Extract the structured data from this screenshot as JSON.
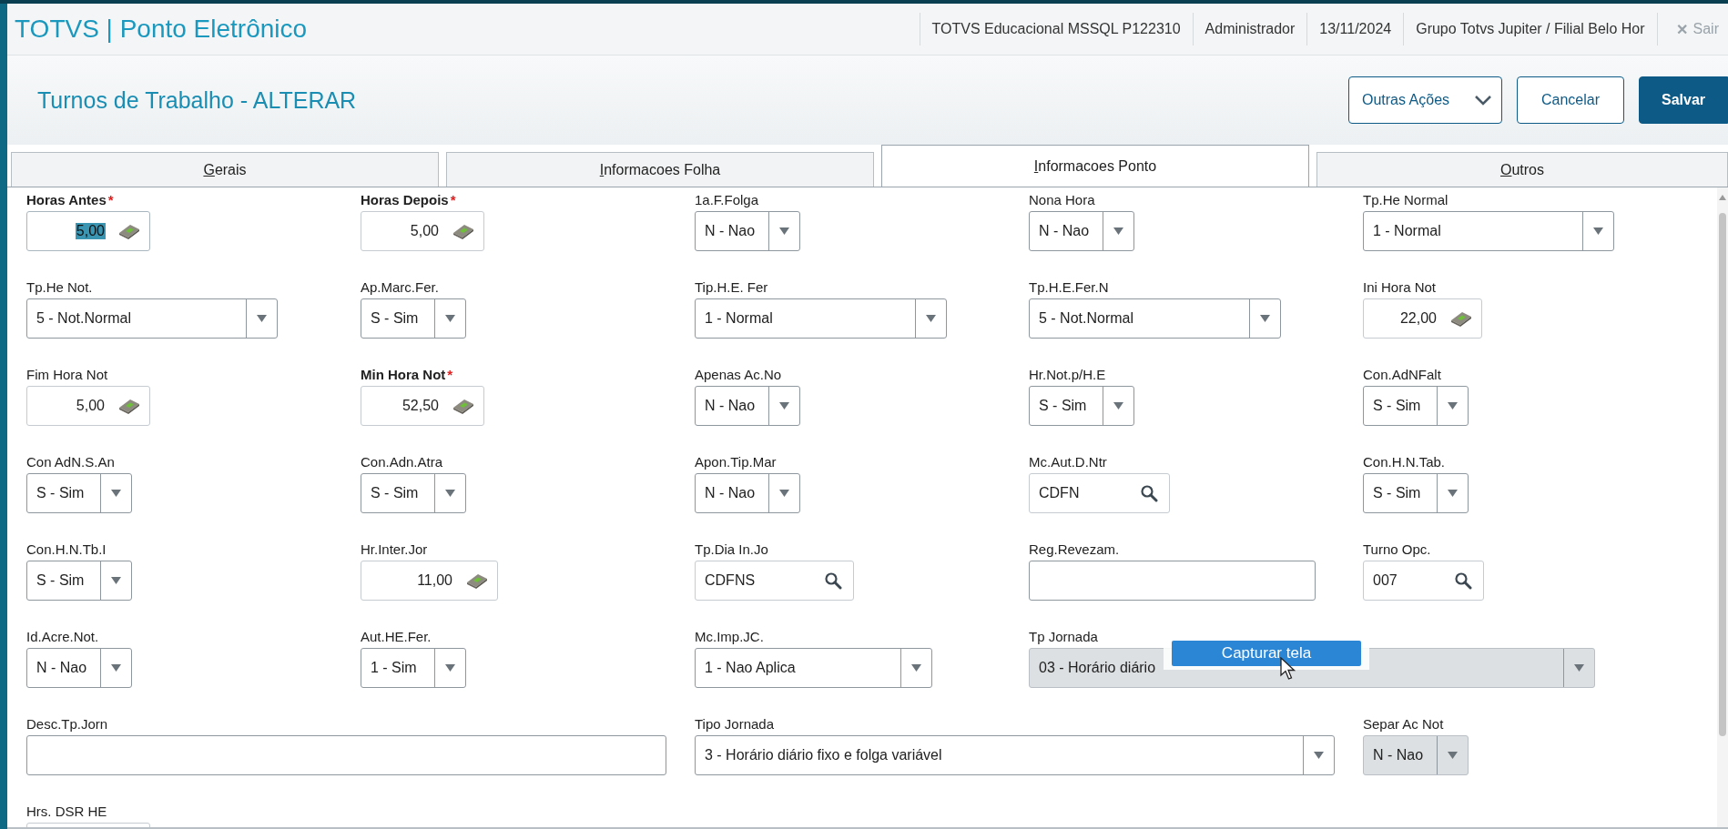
{
  "app_bar": {
    "title": "TOTVS | Ponto Eletrônico",
    "info": [
      "TOTVS Educacional MSSQL P122310",
      "Administrador",
      "13/11/2024",
      "Grupo Totvs Jupiter / Filial Belo Hor"
    ],
    "exit": {
      "icon": "✕",
      "label": "Sair",
      "disabled": true
    }
  },
  "page": {
    "title": "Turnos de Trabalho - ALTERAR",
    "buttons": [
      {
        "label": "Outras Ações",
        "kind": "menu"
      },
      {
        "label": "Cancelar",
        "kind": "secondary"
      },
      {
        "label": "Salvar",
        "kind": "primary"
      }
    ]
  },
  "tabs": [
    {
      "label": "Gerais",
      "selected": false
    },
    {
      "label": "Informacoes Folha",
      "selected": false
    },
    {
      "label": "Informacoes Ponto",
      "selected": true
    },
    {
      "label": "Outros",
      "selected": false
    }
  ],
  "fields": [
    {
      "label": "Horas Antes",
      "required_mark": "*",
      "kind": "number",
      "value": "5,00",
      "value_highlighted": true,
      "disabled": false
    },
    {
      "label": "Horas Depois",
      "required_mark": "*",
      "kind": "number",
      "value": "5,00",
      "value_highlighted": false,
      "disabled": false
    },
    {
      "label": "1a.F.Folga",
      "kind": "select",
      "value": "N - Nao",
      "disabled": false
    },
    {
      "label": "Nona Hora",
      "kind": "select",
      "value": "N - Nao",
      "disabled": false
    },
    {
      "label": "Tp.He Normal",
      "kind": "select",
      "value": "1 - Normal",
      "disabled": false
    },
    {
      "label": "Tp.He Not.",
      "kind": "select",
      "value": "5 - Not.Normal",
      "disabled": false
    },
    {
      "label": "Ap.Marc.Fer.",
      "kind": "select",
      "value": "S - Sim",
      "disabled": false
    },
    {
      "label": "Tip.H.E. Fer",
      "kind": "select",
      "value": "1 - Normal",
      "disabled": false
    },
    {
      "label": "Tp.H.E.Fer.N",
      "kind": "select",
      "value": "5 - Not.Normal",
      "disabled": false
    },
    {
      "label": "Ini Hora Not",
      "kind": "number",
      "value": "22,00",
      "value_highlighted": false,
      "disabled": false
    },
    {
      "label": "Fim Hora Not",
      "kind": "number",
      "value": "5,00",
      "value_highlighted": false,
      "disabled": false
    },
    {
      "label": "Min Hora Not",
      "required_mark": "*",
      "kind": "number",
      "value": "52,50",
      "value_highlighted": false,
      "disabled": false
    },
    {
      "label": "Apenas Ac.No",
      "kind": "select",
      "value": "N - Nao",
      "disabled": false
    },
    {
      "label": "Hr.Not.p/H.E",
      "kind": "select",
      "value": "S - Sim",
      "disabled": false
    },
    {
      "label": "Con.AdNFalt",
      "kind": "select",
      "value": "S - Sim",
      "disabled": false
    },
    {
      "label": "Con AdN.S.An",
      "kind": "select",
      "value": "S - Sim",
      "disabled": false
    },
    {
      "label": "Con.Adn.Atra",
      "kind": "select",
      "value": "S - Sim",
      "disabled": false
    },
    {
      "label": "Apon.Tip.Mar",
      "kind": "select",
      "value": "N - Nao",
      "disabled": false
    },
    {
      "label": "Mc.Aut.D.Ntr",
      "kind": "lookup",
      "value": "CDFN",
      "disabled": false
    },
    {
      "label": "Con.H.N.Tab.",
      "kind": "select",
      "value": "S - Sim",
      "disabled": false
    },
    {
      "label": "Con.H.N.Tb.I",
      "kind": "select",
      "value": "S - Sim",
      "disabled": false
    },
    {
      "label": "Hr.Inter.Jor",
      "kind": "number",
      "value": "11,00",
      "value_highlighted": false,
      "disabled": false
    },
    {
      "label": "Tp.Dia In.Jo",
      "kind": "lookup",
      "value": "CDFNS",
      "disabled": false
    },
    {
      "label": "Reg.Revezam.",
      "kind": "text",
      "disabled": false
    },
    {
      "label": "Turno Opc.",
      "kind": "lookup",
      "value": "007",
      "disabled": false
    },
    {
      "label": "Id.Acre.Not.",
      "kind": "select",
      "value": "N - Nao",
      "disabled": false
    },
    {
      "label": "Aut.HE.Fer.",
      "kind": "select",
      "value": "1 - Sim",
      "disabled": false
    },
    {
      "label": "Mc.Imp.JC.",
      "kind": "select",
      "value": "1 - Nao Aplica",
      "disabled": false
    },
    {
      "label": "Tp Jornada",
      "kind": "select",
      "value": "03 - Horário diário",
      "disabled": true
    },
    {
      "label": "Desc.Tp.Jorn",
      "kind": "text",
      "disabled": false
    },
    {
      "label": "Tipo Jornada",
      "kind": "select",
      "value": "3 - Horário diário fixo e folga variável",
      "disabled": false
    },
    {
      "label": "Separ Ac Not",
      "kind": "select",
      "value": "N - Nao",
      "disabled": true
    },
    {
      "label": "Hrs. DSR HE",
      "kind": "number",
      "disabled": false
    }
  ],
  "popup": {
    "label": "Capturar tela"
  }
}
